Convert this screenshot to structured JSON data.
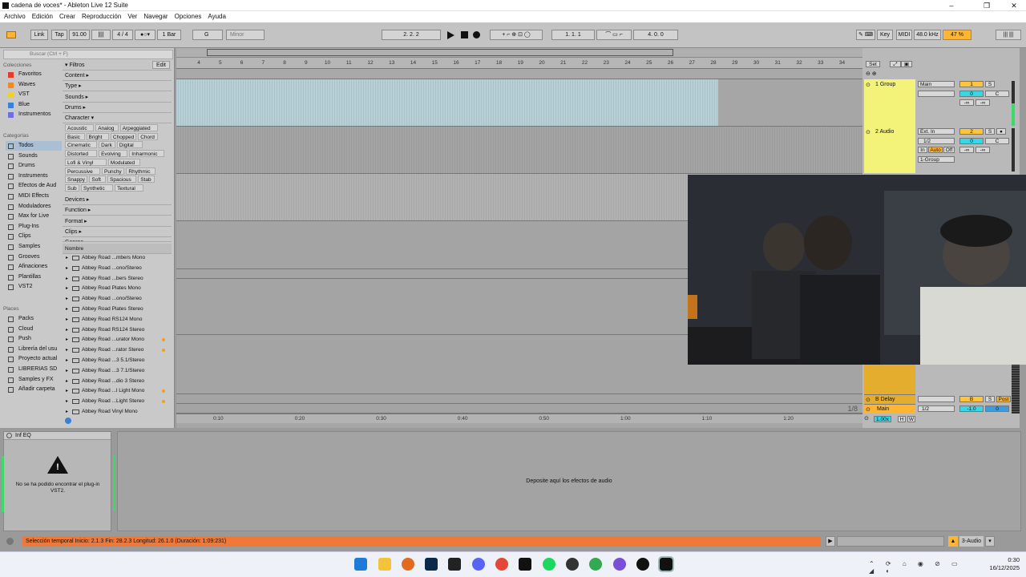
{
  "window": {
    "title": "cadena de voces* - Ableton Live 12 Suite"
  },
  "menu": [
    "Archivo",
    "Edición",
    "Crear",
    "Reproducción",
    "Ver",
    "Navegar",
    "Opciones",
    "Ayuda"
  ],
  "control_bar": {
    "link": "Link",
    "tap": "Tap",
    "tempo": "91.00",
    "signature": "4 / 4",
    "quantize": "1 Bar",
    "key": "G",
    "scale": "Minor",
    "position": "2.   2.   2",
    "loop_start": "1.   1.   1",
    "loop_length": "4.   0.   0",
    "key_label": "Key",
    "midi_label": "MIDI",
    "sample_rate": "48.0 kHz",
    "cpu": "47 %"
  },
  "browser": {
    "search_placeholder": "Buscar (Ctrl + F)",
    "collections_header": "Colecciones",
    "collections": [
      {
        "label": "Favoritos",
        "color": "#e33b2e"
      },
      {
        "label": "Waves",
        "color": "#f08a1c"
      },
      {
        "label": "VST",
        "color": "#f2d21c"
      },
      {
        "label": "Blue",
        "color": "#3a7fd8"
      },
      {
        "label": "Instrumentos",
        "color": "#6f6fe0"
      }
    ],
    "categories_header": "Categorías",
    "categories": [
      "Todos",
      "Sounds",
      "Drums",
      "Instruments",
      "Efectos de Aud",
      "MIDI Effects",
      "Moduladores",
      "Max for Live",
      "Plug-Ins",
      "Clips",
      "Samples",
      "Grooves",
      "Afinaciones",
      "Plantillas",
      "VST2"
    ],
    "places_header": "Places",
    "places": [
      "Packs",
      "Cloud",
      "Push",
      "Librería del usu",
      "Proyecto actual",
      "LIBRERIAS SD",
      "Samples y FX",
      "Añadir carpeta"
    ],
    "filters_label": "Filtros",
    "edit_label": "Edit",
    "filter_sections": [
      "Content ▸",
      "Type ▸",
      "Sounds ▸",
      "Drums ▸",
      "Character ▾"
    ],
    "character_tags": [
      [
        "Acoustic",
        "Analog",
        "Arpeggiated"
      ],
      [
        "Basic",
        "Bright",
        "Chopped",
        "Chord"
      ],
      [
        "Cinematic",
        "Dark",
        "Digital"
      ],
      [
        "Distorted",
        "Evolving",
        "Inharmonic"
      ],
      [
        "Lofi & Vinyl",
        "Modulated"
      ],
      [
        "Percussive",
        "Punchy",
        "Rhythmic"
      ],
      [
        "Snappy",
        "Soft",
        "Spacious",
        "Stab"
      ],
      [
        "Sub",
        "Synthetic",
        "Textural"
      ]
    ],
    "more_sections": [
      "Devices ▸",
      "Function ▸",
      "Format ▸",
      "Clips ▸",
      "Genres"
    ],
    "name_header": "Nombre",
    "files": [
      {
        "name": "Abbey Road ...mbers Mono",
        "fav": false
      },
      {
        "name": "Abbey Road ...ono/Stereo",
        "fav": false
      },
      {
        "name": "Abbey Road ...bers Stereo",
        "fav": false
      },
      {
        "name": "Abbey Road Plates Mono",
        "fav": false
      },
      {
        "name": "Abbey Road ...ono/Stereo",
        "fav": false
      },
      {
        "name": "Abbey Road Plates Stereo",
        "fav": false
      },
      {
        "name": "Abbey Road RS124 Mono",
        "fav": false
      },
      {
        "name": "Abbey Road RS124 Stereo",
        "fav": false
      },
      {
        "name": "Abbey Road ...urator Mono",
        "fav": true
      },
      {
        "name": "Abbey Road ...rator Stereo",
        "fav": true
      },
      {
        "name": "Abbey Road ...3 5.1/Stereo",
        "fav": false
      },
      {
        "name": "Abbey Road ...3 7.1/Stereo",
        "fav": false
      },
      {
        "name": "Abbey Road ...dio 3 Stereo",
        "fav": false
      },
      {
        "name": "Abbey Road ...l Light Mono",
        "fav": true
      },
      {
        "name": "Abbey Road ...Light Stereo",
        "fav": true
      },
      {
        "name": "Abbey Road Vinyl Mono",
        "fav": false
      }
    ]
  },
  "arrangement": {
    "bar_numbers": [
      "4",
      "5",
      "6",
      "7",
      "8",
      "9",
      "10",
      "11",
      "12",
      "13",
      "14",
      "15",
      "16",
      "17",
      "18",
      "19",
      "20",
      "21",
      "22",
      "23",
      "24",
      "25",
      "26",
      "27",
      "28",
      "29",
      "30",
      "31",
      "32",
      "33",
      "34"
    ],
    "time_labels": [
      "0:10",
      "0:20",
      "0:30",
      "0:40",
      "0:50",
      "1:00",
      "1:10",
      "1:20"
    ],
    "zoom_hint": "1/8"
  },
  "mixer": {
    "set_label": "Set",
    "tracks": [
      {
        "name": "1 Group",
        "routing": "Main",
        "number": "1",
        "volume": "0",
        "pan": "C",
        "peaks": [
          "-∞",
          "-∞"
        ]
      },
      {
        "name": "2 Audio",
        "routing": "Ext. In",
        "input": "1/2",
        "number": "2",
        "volume": "0",
        "pan": "C",
        "peaks": [
          "-∞",
          "-∞"
        ],
        "monitor": [
          "In",
          "Auto",
          "Off"
        ],
        "output": "1-Group"
      }
    ],
    "returns": [
      {
        "name": "B Delay",
        "number": "B",
        "post": "Post"
      }
    ],
    "main": {
      "name": "Main",
      "output": "1/2",
      "volume": "-1.0",
      "value": "0",
      "zoom": "1.00x",
      "h": "H",
      "w": "W"
    }
  },
  "devices": {
    "device_title": "Inf EQ",
    "error_text": "No se ha podido encontrar el plug-in VST2.",
    "drop_text": "Deposite aquí los efectos de audio"
  },
  "status": {
    "text": "Selección temporal    Inicio: 2.1.3    Fin: 28.2.3    Longitud: 26.1.0  (Duración: 1:09:231)",
    "track_label": "3-Audio"
  },
  "taskbar": {
    "time": "0:30",
    "date": "16/12/2025"
  }
}
